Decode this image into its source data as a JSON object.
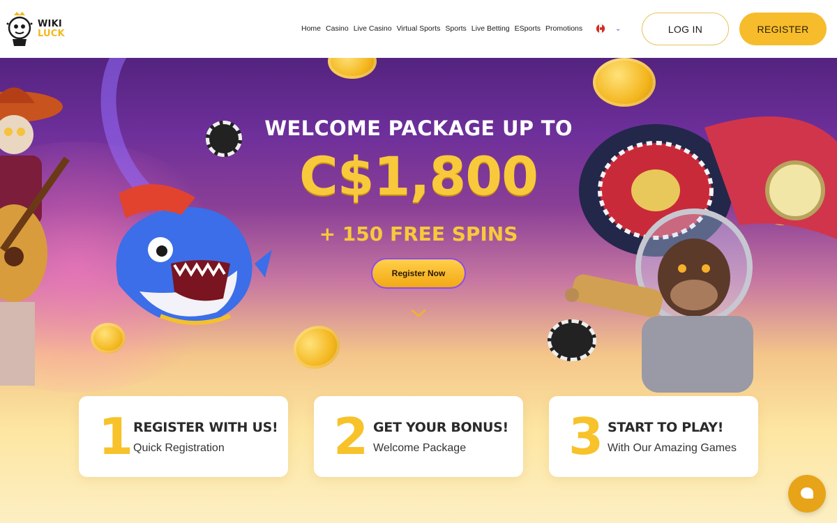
{
  "brand": {
    "line1": "WIKI",
    "line2": "LUCK"
  },
  "nav": {
    "items": [
      "Home",
      "Casino",
      "Live Casino",
      "Virtual Sports",
      "Sports",
      "Live Betting",
      "ESports",
      "Promotions"
    ]
  },
  "language": {
    "flag": "canada-flag-icon"
  },
  "auth": {
    "login_label": "LOG IN",
    "register_label": "REGISTER"
  },
  "hero": {
    "headline": "WELCOME PACKAGE UP TO",
    "amount": "C$1,800",
    "spins": "+ 150 FREE SPINS",
    "cta_label": "Register Now"
  },
  "steps": [
    {
      "num": "1",
      "title": "REGISTER WITH US!",
      "sub": "Quick Registration"
    },
    {
      "num": "2",
      "title": "GET YOUR BONUS!",
      "sub": "Welcome Package"
    },
    {
      "num": "3",
      "title": "START TO PLAY!",
      "sub": "With Our Amazing Games"
    }
  ],
  "colors": {
    "accent": "#f7bc2c",
    "purple": "#6d2f9a",
    "text": "#1a1a1a"
  }
}
